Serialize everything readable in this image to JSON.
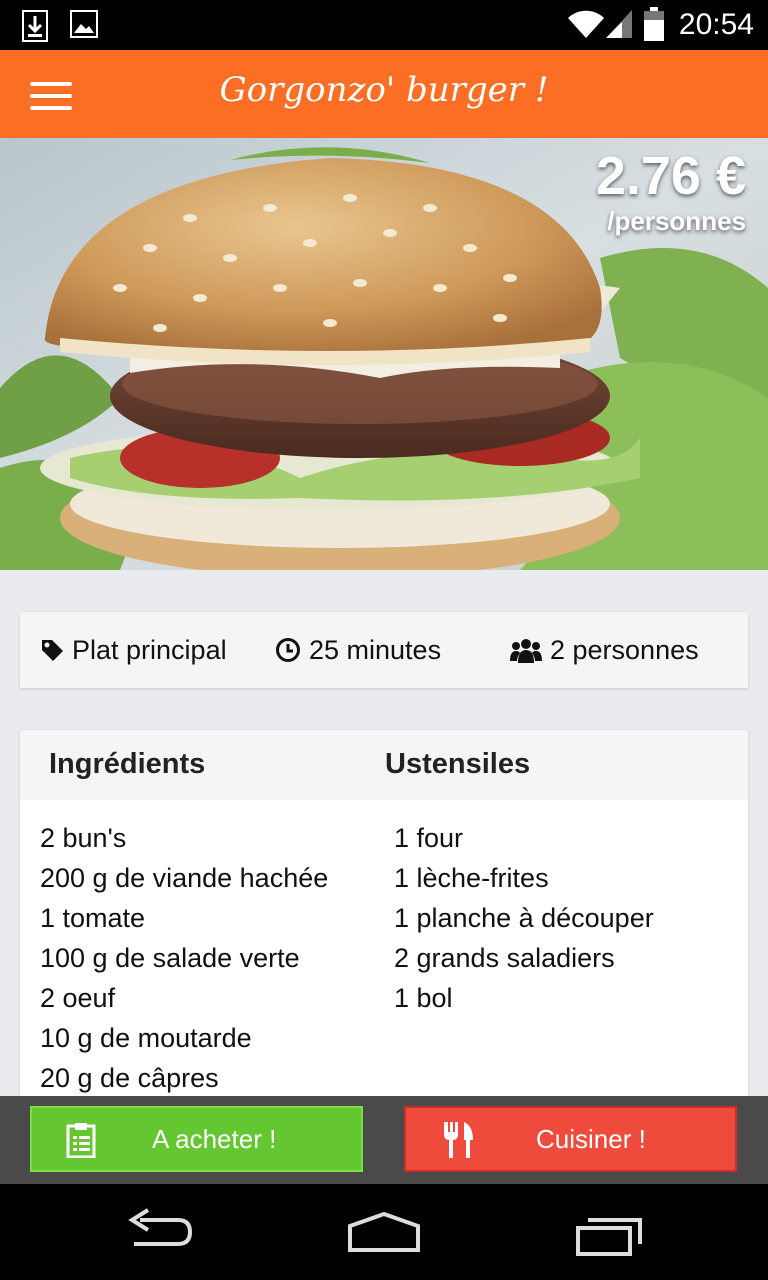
{
  "status_bar": {
    "time": "20:54"
  },
  "app_bar": {
    "title": "Gorgonzo' burger !"
  },
  "hero": {
    "price": "2.76 €",
    "price_unit": "/personnes"
  },
  "info": {
    "category": "Plat principal",
    "duration": "25 minutes",
    "servings": "2 personnes"
  },
  "lists": {
    "ingredients_title": "Ingrédients",
    "utensils_title": "Ustensiles",
    "ingredients": [
      "2 bun's",
      "200 g de viande hachée",
      "1 tomate",
      "100 g de salade verte",
      "2 oeuf",
      "10 g de moutarde",
      "20 g de câpres"
    ],
    "utensils": [
      "1 four",
      "1 lèche-frites",
      "1 planche à découper",
      "2 grands saladiers",
      "1 bol"
    ]
  },
  "actions": {
    "buy_label": "A acheter !",
    "cook_label": "Cuisiner !"
  },
  "colors": {
    "accent": "#fc6e24",
    "buy": "#64c732",
    "cook": "#ee4b3c"
  },
  "icons": [
    "download-icon",
    "image-icon",
    "wifi-icon",
    "signal-icon",
    "battery-icon",
    "menu-icon",
    "tag-icon",
    "clock-icon",
    "group-icon",
    "clipboard-icon",
    "cutlery-icon",
    "back-icon",
    "home-icon",
    "recents-icon"
  ]
}
